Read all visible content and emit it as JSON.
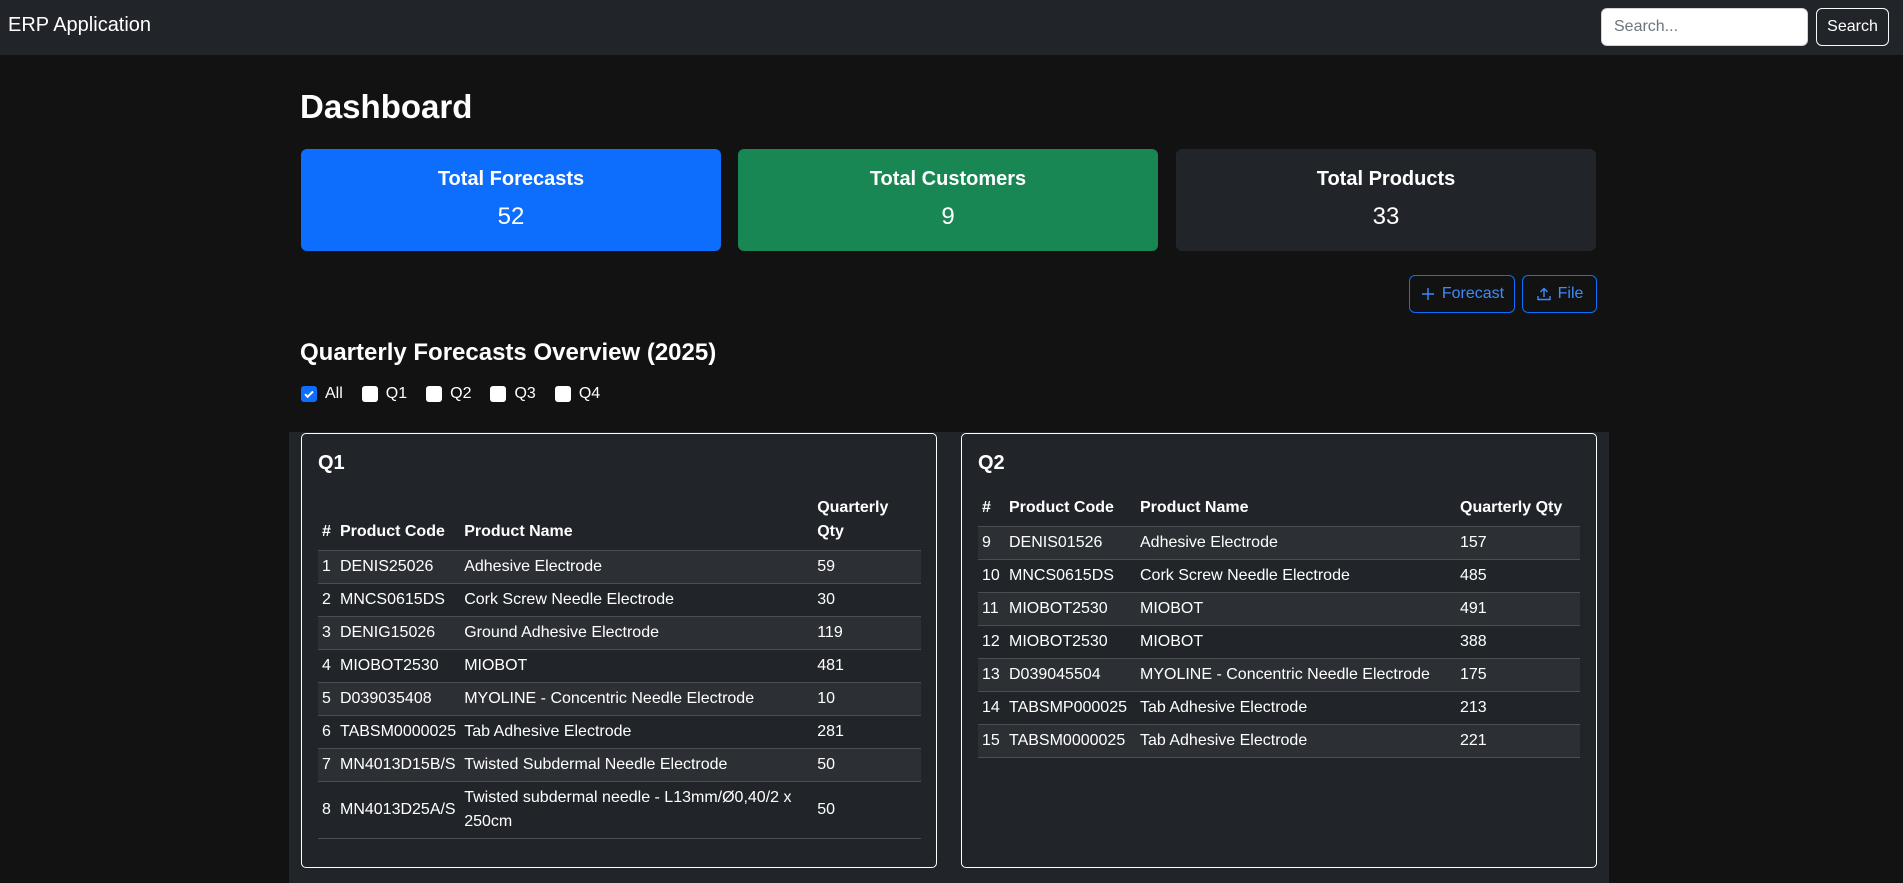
{
  "navbar": {
    "brand": "ERP Application",
    "search_placeholder": "Search...",
    "search_button": "Search"
  },
  "page": {
    "title": "Dashboard"
  },
  "stats": [
    {
      "title": "Total Forecasts",
      "value": "52",
      "color": "#0d6efd"
    },
    {
      "title": "Total Customers",
      "value": "9",
      "color": "#198754"
    },
    {
      "title": "Total Products",
      "value": "33",
      "color": "#212529"
    }
  ],
  "actions": {
    "forecast_label": "Forecast",
    "file_label": "File",
    "forecast_icon": "plus-icon",
    "file_icon": "upload-icon"
  },
  "overview": {
    "title": "Quarterly Forecasts Overview (2025)",
    "filters": [
      {
        "label": "All",
        "checked": true
      },
      {
        "label": "Q1",
        "checked": false
      },
      {
        "label": "Q2",
        "checked": false
      },
      {
        "label": "Q3",
        "checked": false
      },
      {
        "label": "Q4",
        "checked": false
      }
    ]
  },
  "q1": {
    "title": "Q1",
    "headers": [
      "#",
      "Product Code",
      "Product Name",
      "Quarterly Qty"
    ],
    "rows": [
      [
        "1",
        "DENIS25026",
        "Adhesive Electrode",
        "59"
      ],
      [
        "2",
        "MNCS0615DS",
        "Cork Screw Needle Electrode",
        "30"
      ],
      [
        "3",
        "DENIG15026",
        "Ground Adhesive Electrode",
        "119"
      ],
      [
        "4",
        "MIOBOT2530",
        "MIOBOT",
        "481"
      ],
      [
        "5",
        "D039035408",
        "MYOLINE - Concentric Needle Electrode",
        "10"
      ],
      [
        "6",
        "TABSM0000025",
        "Tab Adhesive Electrode",
        "281"
      ],
      [
        "7",
        "MN4013D15B/S",
        "Twisted Subdermal Needle Electrode",
        "50"
      ],
      [
        "8",
        "MN4013D25A/S",
        "Twisted subdermal needle - L13mm/Ø0,40/2 x 250cm",
        "50"
      ]
    ]
  },
  "q2": {
    "title": "Q2",
    "headers": [
      "#",
      "Product Code",
      "Product Name",
      "Quarterly Qty"
    ],
    "rows": [
      [
        "9",
        "DENIS01526",
        "Adhesive Electrode",
        "157"
      ],
      [
        "10",
        "MNCS0615DS",
        "Cork Screw Needle Electrode",
        "485"
      ],
      [
        "11",
        "MIOBOT2530",
        "MIOBOT",
        "491"
      ],
      [
        "12",
        "MIOBOT2530",
        "MIOBOT",
        "388"
      ],
      [
        "13",
        "D039045504",
        "MYOLINE - Concentric Needle Electrode",
        "175"
      ],
      [
        "14",
        "TABSMP000025",
        "Tab Adhesive Electrode",
        "213"
      ],
      [
        "15",
        "TABSM0000025",
        "Tab Adhesive Electrode",
        "221"
      ]
    ]
  }
}
